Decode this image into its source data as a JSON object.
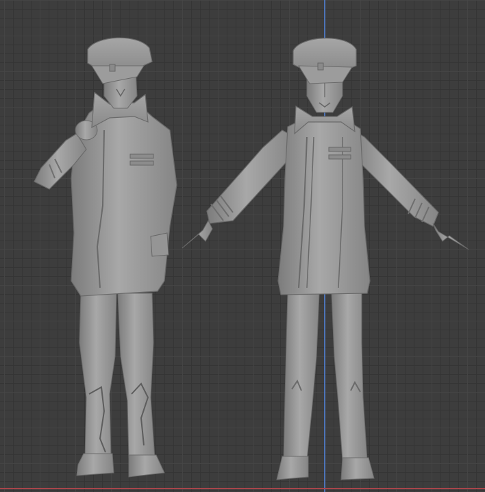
{
  "viewport": {
    "background": "#3d3d3d",
    "grid_major": "#464646",
    "grid_minor": "#343434",
    "axis_y_color": "#4d74b8",
    "axis_x_color": "#a8454a",
    "clay_color": "#9a9a9a",
    "clay_shadow": "#6f6f6f",
    "clay_highlight": "#b8b8b8"
  },
  "models": [
    {
      "name": "posed-figure",
      "pose": "hand-to-collar"
    },
    {
      "name": "t-pose-figure",
      "pose": "a-pose"
    }
  ]
}
